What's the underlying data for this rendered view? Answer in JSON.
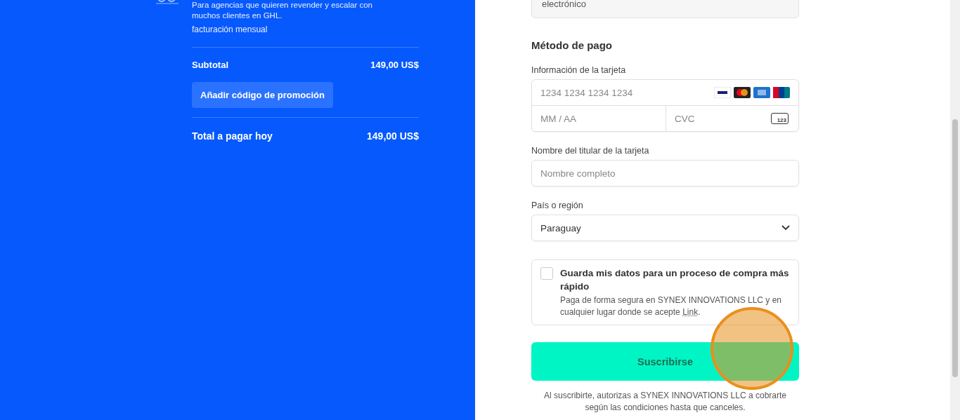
{
  "order": {
    "description": "Para agencias que quieren revender y escalar con muchos clientes en GHL.",
    "billing": "facturación mensual",
    "subtotal_label": "Subtotal",
    "subtotal_value": "149,00 US$",
    "promo_button": "Añadir código de promoción",
    "total_label": "Total a pagar hoy",
    "total_value": "149,00 US$"
  },
  "email_field": {
    "value": "electrónico"
  },
  "payment": {
    "heading": "Método de pago",
    "card_label": "Información de la tarjeta",
    "card_number_placeholder": "1234 1234 1234 1234",
    "expiry_placeholder": "MM / AA",
    "cvc_placeholder": "CVC",
    "cvc_icon_text": "123",
    "holder_label": "Nombre del titular de la tarjeta",
    "holder_placeholder": "Nombre completo",
    "country_label": "País o región",
    "country_value": "Paraguay"
  },
  "save_info": {
    "checked": false,
    "title": "Guarda mis datos para un proceso de compra más rápido",
    "text": "Paga de forma segura en SYNEX INNOVATIONS LLC y en cualquier lugar donde se acepte",
    "link": "Link",
    "end": "."
  },
  "subscribe_button": "Suscribirse",
  "terms": "Al suscribirte, autorizas a SYNEX INNOVATIONS LLC a cobrarte según las condiciones hasta que canceles.",
  "click_marker": {
    "shown": true
  }
}
